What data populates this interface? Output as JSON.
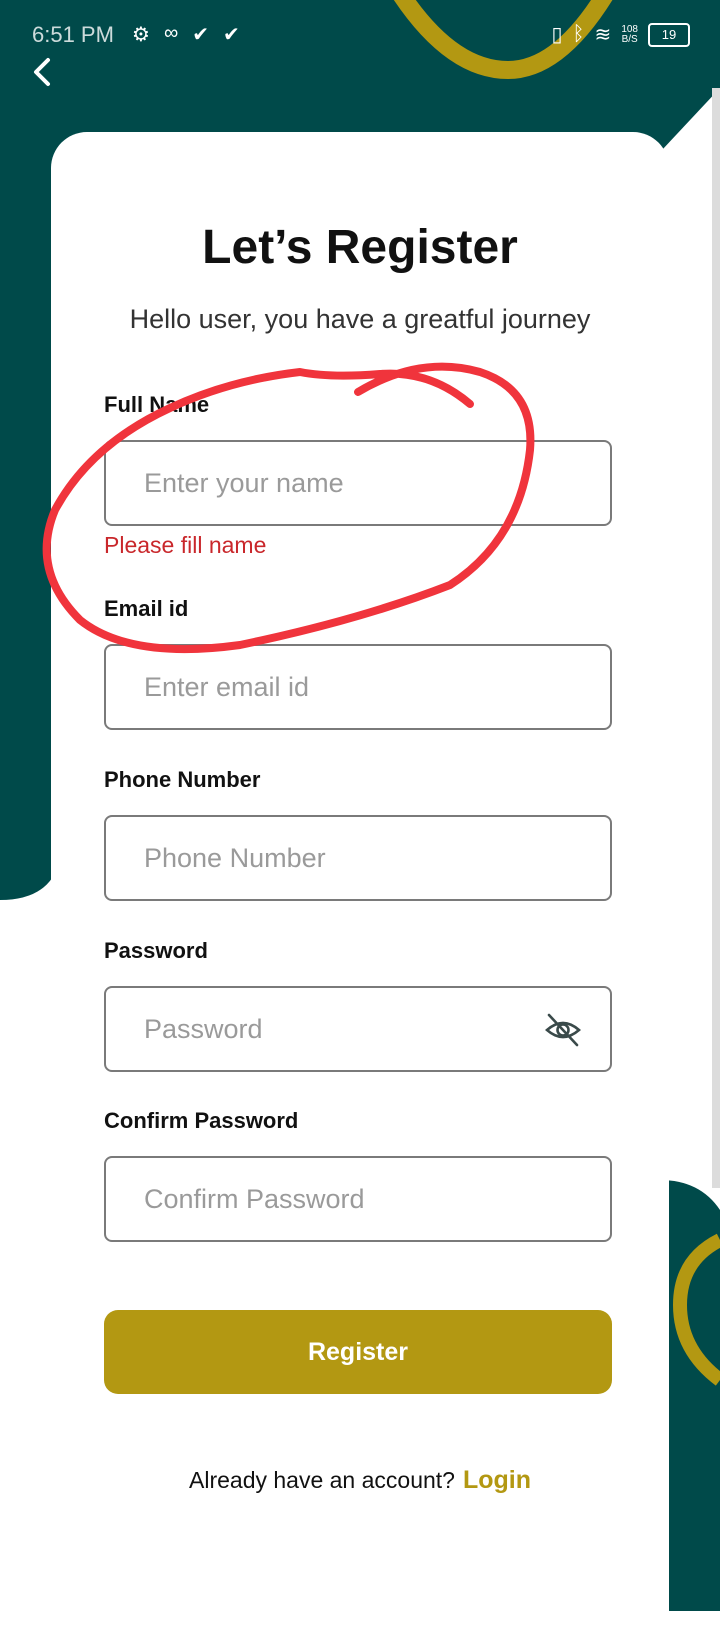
{
  "status_bar": {
    "time": "6:51 PM",
    "net_speed_value": "108",
    "net_speed_unit": "B/S",
    "battery": "19"
  },
  "colors": {
    "primary_teal": "#004a4a",
    "accent_gold": "#b39812",
    "error_red": "#c9272b",
    "annotation_red": "#f0343c"
  },
  "header": {
    "title": "Let’s Register",
    "subtitle": "Hello user, you have a greatful journey"
  },
  "form": {
    "full_name": {
      "label": "Full Name",
      "placeholder": "Enter your name",
      "value": "",
      "error": "Please fill name"
    },
    "email": {
      "label": "Email id",
      "placeholder": "Enter email id",
      "value": ""
    },
    "phone": {
      "label": "Phone Number",
      "placeholder": "Phone Number",
      "value": ""
    },
    "password": {
      "label": "Password",
      "placeholder": "Password",
      "value": "",
      "toggle_icon": "eye-off-icon"
    },
    "confirm_password": {
      "label": "Confirm Password",
      "placeholder": "Confirm Password",
      "value": ""
    },
    "register_label": "Register"
  },
  "footer": {
    "prompt": "Already have an account?",
    "login_label": "Login"
  },
  "icons": {
    "back": "chevron-left-icon",
    "settings": "gear-icon",
    "infinity": "infinity-icon",
    "check": "checkmark-icon",
    "vibrate": "vibrate-icon",
    "bluetooth": "bluetooth-icon",
    "wifi": "wifi-icon",
    "battery": "battery-icon"
  }
}
